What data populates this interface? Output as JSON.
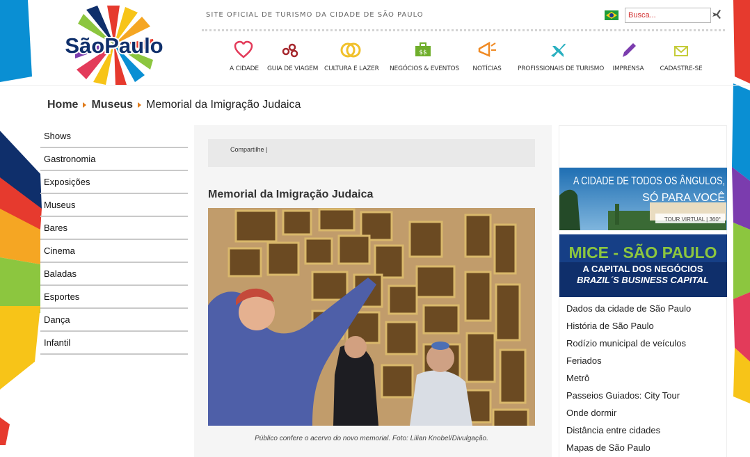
{
  "header": {
    "logo_text": "SãoPaulo",
    "tagline": "SITE OFICIAL DE TURISMO DA CIDADE DE SÃO PAULO",
    "search_placeholder": "Busca..."
  },
  "nav": [
    {
      "label": "A CIDADE",
      "icon": "heart-icon",
      "color": "#e33b5a"
    },
    {
      "label": "GUIA DE VIAGEM",
      "icon": "map-dots-icon",
      "color": "#a5262c"
    },
    {
      "label": "CULTURA E LAZER",
      "icon": "rings-icon",
      "color": "#f1c12c"
    },
    {
      "label": "NEGÓCIOS & EVENTOS",
      "icon": "briefcase-icon",
      "color": "#6fae2b"
    },
    {
      "label": "NOTÍCIAS",
      "icon": "megaphone-icon",
      "color": "#f08a24"
    },
    {
      "label": "PROFISSIONAIS DE TURISMO",
      "icon": "plane-icon",
      "color": "#2ab0c0"
    },
    {
      "label": "IMPRENSA",
      "icon": "pen-icon",
      "color": "#7b3cae"
    },
    {
      "label": "CADASTRE-SE",
      "icon": "envelope-icon",
      "color": "#c5cc3a"
    }
  ],
  "breadcrumb": {
    "home": "Home",
    "section": "Museus",
    "current": "Memorial da Imigração Judaica"
  },
  "sidebar": {
    "items": [
      "Shows",
      "Gastronomia",
      "Exposições",
      "Museus",
      "Bares",
      "Cinema",
      "Baladas",
      "Esportes",
      "Dança",
      "Infantil"
    ]
  },
  "main": {
    "share_label": "Compartilhe  |",
    "title": "Memorial da Imigração Judaica",
    "caption": "Público confere o acervo do novo memorial. Foto: Lilian Knobel/Divulgação."
  },
  "right": {
    "banner1": {
      "line1": "A CIDADE DE TODOS OS ÂNGULOS,",
      "line2": "SÓ PARA VOCÊ",
      "badge": "TOUR VIRTUAL | 360°"
    },
    "banner2": {
      "line1": "MICE - SÃO PAULO",
      "line2": "A CAPITAL DOS NEGÓCIOS",
      "line3": "BRAZIL´S BUSINESS CAPITAL"
    },
    "links": [
      "Dados da cidade de São Paulo",
      "História de São Paulo",
      "Rodízio municipal de veículos",
      "Feriados",
      "Metrô",
      "Passeios Guiados: City Tour",
      "Onde dormir",
      "Distância entre cidades",
      "Mapas de São Paulo"
    ]
  },
  "colors": {
    "accent_orange": "#e07b1a",
    "banner2_bg": "#0f2f6b",
    "banner2_green": "#8cc63f"
  }
}
